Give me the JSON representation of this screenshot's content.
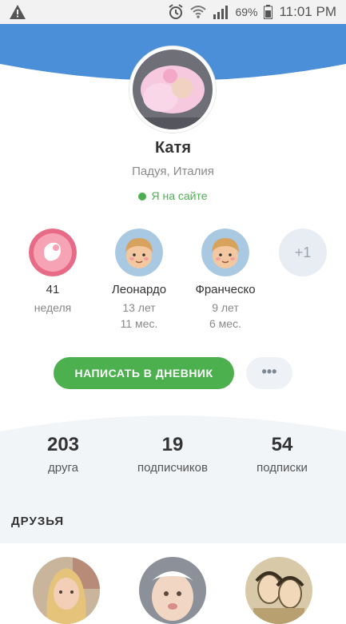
{
  "status": {
    "battery": "69%",
    "time": "11:01 PM"
  },
  "profile": {
    "name": "Катя",
    "location": "Падуя, Италия",
    "online": "Я на сайте"
  },
  "kids": [
    {
      "top": "41",
      "bottom": "неделя"
    },
    {
      "top": "Леонардо",
      "line1": "13 лет",
      "line2": "11 мес."
    },
    {
      "top": "Франческо",
      "line1": "9 лет",
      "line2": "6 мес."
    }
  ],
  "more_kids": "+1",
  "actions": {
    "diary": "НАПИСАТЬ В ДНЕВНИК",
    "more": "•••"
  },
  "stats": [
    {
      "num": "203",
      "label": "друга"
    },
    {
      "num": "19",
      "label": "подписчиков"
    },
    {
      "num": "54",
      "label": "подписки"
    }
  ],
  "friends_title": "ДРУЗЬЯ",
  "colors": {
    "header_blue": "#4a8fd8",
    "green": "#4cb04f"
  }
}
